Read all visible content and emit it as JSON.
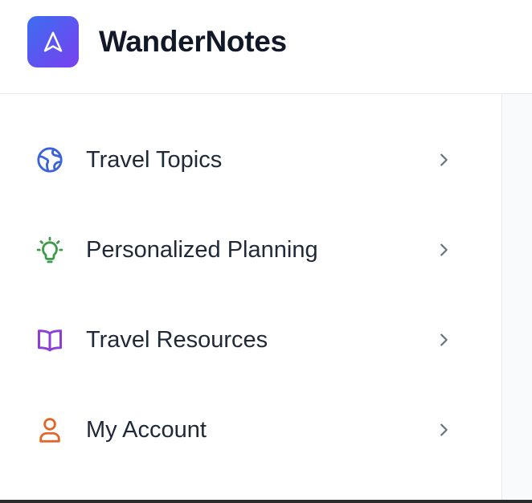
{
  "app": {
    "title": "WanderNotes",
    "logo_icon": "navigation-arrow-icon",
    "logo_gradient": [
      "#3b6ef0",
      "#7a3ff0"
    ]
  },
  "sidebar": {
    "items": [
      {
        "label": "Travel Topics",
        "icon": "globe-icon",
        "color": "#3b63d9"
      },
      {
        "label": "Personalized Planning",
        "icon": "lightbulb-icon",
        "color": "#3f9a4a"
      },
      {
        "label": "Travel Resources",
        "icon": "book-open-icon",
        "color": "#8b3fd6"
      },
      {
        "label": "My Account",
        "icon": "user-icon",
        "color": "#e0662a"
      }
    ]
  }
}
